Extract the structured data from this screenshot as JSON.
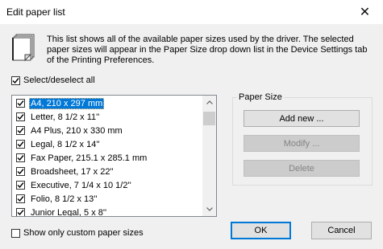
{
  "window": {
    "title": "Edit paper list",
    "close_glyph": "✕"
  },
  "description": "This list shows all of the available paper sizes used by the driver. The selected paper sizes will appear in the Paper Size drop down list in the Device Settings tab of the Printing Preferences.",
  "select_all": {
    "label": "Select/deselect all",
    "checked": true
  },
  "paper_list": {
    "items": [
      {
        "label": "A4, 210 x 297 mm",
        "checked": true,
        "selected": true
      },
      {
        "label": "Letter, 8 1/2 x 11''",
        "checked": true,
        "selected": false
      },
      {
        "label": "A4 Plus, 210 x 330 mm",
        "checked": true,
        "selected": false
      },
      {
        "label": "Legal, 8 1/2 x 14''",
        "checked": true,
        "selected": false
      },
      {
        "label": "Fax Paper, 215.1 x 285.1 mm",
        "checked": true,
        "selected": false
      },
      {
        "label": "Broadsheet, 17 x 22''",
        "checked": true,
        "selected": false
      },
      {
        "label": "Executive, 7 1/4 x 10 1/2''",
        "checked": true,
        "selected": false
      },
      {
        "label": "Folio, 8 1/2 x 13''",
        "checked": true,
        "selected": false
      },
      {
        "label": "Junior Legal, 5 x 8''",
        "checked": true,
        "selected": false
      }
    ]
  },
  "paper_size_group": {
    "label": "Paper Size",
    "add_new": "Add new ...",
    "modify": "Modify ...",
    "delete": "Delete"
  },
  "custom_only": {
    "label": "Show only custom paper sizes",
    "checked": false
  },
  "footer": {
    "ok": "OK",
    "cancel": "Cancel"
  },
  "colors": {
    "selection": "#0078d7",
    "ok_border": "#0078d7"
  }
}
